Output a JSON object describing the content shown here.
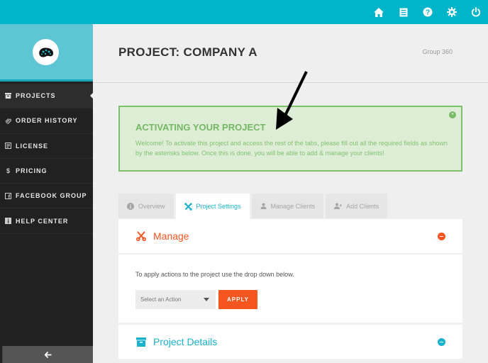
{
  "topbar": {
    "icons": [
      "home-icon",
      "document-icon",
      "help-icon",
      "settings-icon",
      "power-icon"
    ]
  },
  "sidebar": {
    "logo": "brain-logo",
    "items": [
      {
        "label": "PROJECTS",
        "icon": "archive-icon",
        "active": true
      },
      {
        "label": "ORDER HISTORY",
        "icon": "paperclip-icon",
        "active": false
      },
      {
        "label": "LICENSE",
        "icon": "license-icon",
        "active": false
      },
      {
        "label": "PRICING",
        "icon": "dollar-icon",
        "active": false
      },
      {
        "label": "FACEBOOK GROUP",
        "icon": "facebook-icon",
        "active": false
      },
      {
        "label": "HELP CENTER",
        "icon": "info-icon",
        "active": false
      }
    ],
    "dollar_glyph": "$",
    "collapse_icon": "arrow-left-icon"
  },
  "header": {
    "title": "PROJECT: COMPANY A",
    "group": "Group 360"
  },
  "alert": {
    "title": "ACTIVATING YOUR PROJECT",
    "text": "Welcome! To activate this project and access the rest of the tabs, please fill out all the required fields as shown by the asterisks below. Once this is done, you will be able to add & manage your clients!",
    "close_glyph": "×"
  },
  "tabs": [
    {
      "label": "Overview",
      "icon": "info-icon",
      "active": false
    },
    {
      "label": "Project Settings",
      "icon": "tools-icon",
      "active": true
    },
    {
      "label": "Manage Clients",
      "icon": "user-icon",
      "active": false
    },
    {
      "label": "Add Clients",
      "icon": "add-user-icon",
      "active": false
    }
  ],
  "manage": {
    "title": "Manage",
    "color": "#f5551f",
    "description": "To apply actions to the project use the drop down below.",
    "select_value": "Select an Action",
    "apply_label": "APPLY"
  },
  "project_details": {
    "title": "Project Details",
    "color": "#1ab1cc"
  },
  "colors": {
    "topbar": "#00b4c9",
    "sidebar": "#212121",
    "alert_bg": "#deedd5",
    "alert_border": "#7cc16a",
    "accent_orange": "#f5551f",
    "accent_teal": "#1ab1cc"
  }
}
